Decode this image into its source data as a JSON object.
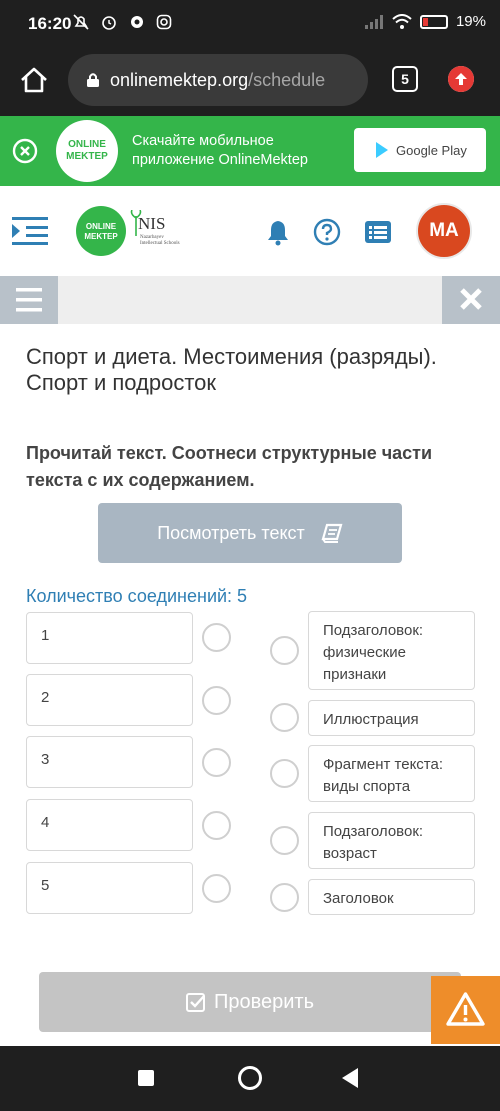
{
  "status_bar": {
    "time": "16:20",
    "battery": "19%"
  },
  "browser": {
    "url_host": "onlinemektep.org",
    "url_path": "/schedule",
    "tab_count": "5"
  },
  "promo": {
    "logo_line1": "ONLINE",
    "logo_line2": "MEKTEP",
    "text": "Скачайте мобильное приложение OnlineMektep",
    "store_label": "Google Play"
  },
  "header": {
    "logo_line1": "ONLINE",
    "logo_line2": "MEKTEP",
    "nis_word": "NIS",
    "nis_sub": "Nazarbayev Intellectual Schools",
    "avatar_initials": "MA"
  },
  "lesson": {
    "title": "Спорт и диета. Местоимения (разряды). Спорт и подросток",
    "task": "Прочитай текст. Соотнеси структурные части текста с их содержанием.",
    "view_text_button": "Посмотреть текст",
    "connections_label": "Количество соединений: 5"
  },
  "left_items": [
    "1",
    "2",
    "3",
    "4",
    "5"
  ],
  "right_items": [
    "Подзаголовок: физические признаки",
    "Иллюстрация",
    "Фрагмент текста: виды спорта",
    "Подзаголовок: возраст",
    "Заголовок"
  ],
  "check_button": "Проверить",
  "colors": {
    "brand_green": "#34b54a",
    "accent_blue": "#2f7fb4",
    "avatar": "#d9481f",
    "warning": "#ee8d2a"
  }
}
